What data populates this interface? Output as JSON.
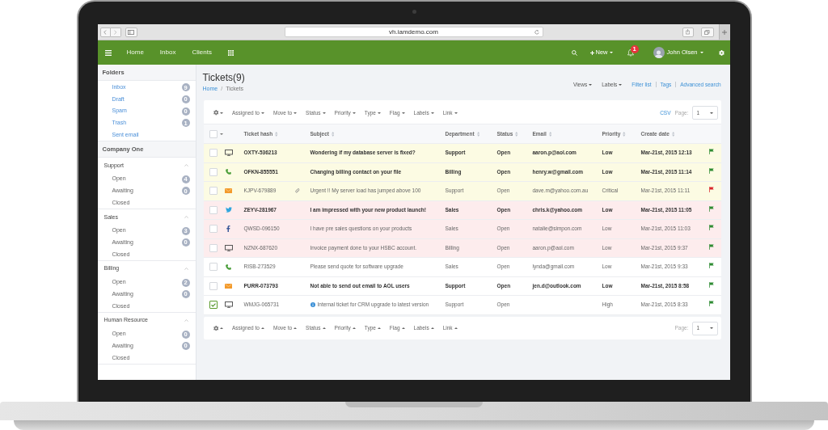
{
  "browser": {
    "url": "vh.iamdemo.com"
  },
  "navbar": {
    "links": [
      {
        "label": "Home"
      },
      {
        "label": "Inbox"
      },
      {
        "label": "Clients"
      }
    ],
    "new_label": "New",
    "notification_count": "1",
    "user_name": "John Olsen"
  },
  "sidebar": {
    "folders_title": "Folders",
    "folders": [
      {
        "label": "Inbox",
        "count": "9"
      },
      {
        "label": "Draft",
        "count": "0"
      },
      {
        "label": "Spam",
        "count": "0"
      },
      {
        "label": "Trash",
        "count": "1"
      },
      {
        "label": "Sent email"
      }
    ],
    "company_title": "Company One",
    "groups": [
      {
        "label": "Support",
        "expanded": true,
        "children": [
          {
            "label": "Open",
            "count": "4"
          },
          {
            "label": "Awaiting",
            "count": "0"
          },
          {
            "label": "Closed"
          }
        ]
      },
      {
        "label": "Sales",
        "expanded": true,
        "children": [
          {
            "label": "Open",
            "count": "3"
          },
          {
            "label": "Awaiting",
            "count": "0"
          },
          {
            "label": "Closed"
          }
        ]
      },
      {
        "label": "Billing",
        "expanded": true,
        "children": [
          {
            "label": "Open",
            "count": "2"
          },
          {
            "label": "Awaiting",
            "count": "0"
          },
          {
            "label": "Closed"
          }
        ]
      },
      {
        "label": "Human Resource",
        "expanded": true,
        "children": [
          {
            "label": "Open",
            "count": "0"
          },
          {
            "label": "Awaiting",
            "count": "0"
          },
          {
            "label": "Closed"
          }
        ]
      }
    ]
  },
  "header": {
    "title": "Tickets(9)",
    "breadcrumb": [
      "Home",
      "Tickets"
    ],
    "breadcrumb_separator": "/",
    "dropdowns": [
      "Views",
      "Labels"
    ],
    "links": [
      "Filter list",
      "Tags",
      "Advanced search"
    ]
  },
  "top_toolbar": {
    "actions": [
      "Assigned to",
      "Move to",
      "Status",
      "Priority",
      "Type",
      "Flag",
      "Labels",
      "Link"
    ],
    "csv_link": "CSV",
    "page_label": "Page:",
    "page_value": "1"
  },
  "table": {
    "all_checked": false,
    "columns": [
      "Ticket hash",
      "Subject",
      "Department",
      "Status",
      "Email",
      "Priority",
      "Create date"
    ],
    "rows": [
      {
        "checked": false,
        "unread": true,
        "color": "#fcfbe3",
        "channel": {
          "kind": "desktop"
        },
        "hash": "OXTY-536213",
        "attachment": false,
        "info": false,
        "subject": "Wondering if my database server is fixed?",
        "department": "Support",
        "status": "Open",
        "email": "aaron.p@aol.com",
        "priority": "Low",
        "created": "Mar-21st, 2015 12:13",
        "flag": {
          "color": "#2e8b32"
        }
      },
      {
        "checked": false,
        "unread": true,
        "color": "#fcfbe3",
        "channel": {
          "kind": "phone"
        },
        "hash": "OFKN-855551",
        "attachment": false,
        "info": false,
        "subject": "Changing billing contact on your file",
        "department": "Billing",
        "status": "Open",
        "email": "henry.w@gmail.com",
        "priority": "Low",
        "created": "Mar-21st, 2015 11:14",
        "flag": {
          "color": "#2e8b32"
        }
      },
      {
        "checked": false,
        "unread": false,
        "color": "#fcfbe3",
        "channel": {
          "kind": "email"
        },
        "hash": "KJPV-679889",
        "attachment": true,
        "info": false,
        "subject": "Urgent !! My server load has jumped above 100",
        "department": "Support",
        "status": "Open",
        "email": "dave.m@yahoo.com.au",
        "priority": "Critical",
        "created": "Mar-21st, 2015 11:11",
        "flag": {
          "color": "#d9262c"
        }
      },
      {
        "checked": false,
        "unread": true,
        "color": "#fdeced",
        "channel": {
          "kind": "twitter"
        },
        "hash": "ZEYV-281967",
        "attachment": false,
        "info": false,
        "subject": "I am impressed with your new product launch!",
        "department": "Sales",
        "status": "Open",
        "email": "chris.k@yahoo.com",
        "priority": "Low",
        "created": "Mar-21st, 2015 11:05",
        "flag": {
          "color": "#2e8b32"
        }
      },
      {
        "checked": false,
        "unread": false,
        "color": "#fdeced",
        "channel": {
          "kind": "facebook"
        },
        "hash": "QWSD-096150",
        "attachment": false,
        "info": false,
        "subject": "I have pre sales questions on your products",
        "department": "Sales",
        "status": "Open",
        "email": "natalie@simpon.com",
        "priority": "Low",
        "created": "Mar-21st, 2015 11:03",
        "flag": {
          "color": "#2e8b32"
        }
      },
      {
        "checked": false,
        "unread": false,
        "color": "#fdeced",
        "channel": {
          "kind": "desktop"
        },
        "hash": "NZNX-687620",
        "attachment": false,
        "info": false,
        "subject": "Invoice payment done to your HSBC account.",
        "department": "Billing",
        "status": "Open",
        "email": "aaron.p@aol.com",
        "priority": "Low",
        "created": "Mar-21st, 2015 9:37",
        "flag": {
          "color": "#2e8b32"
        }
      },
      {
        "checked": false,
        "unread": false,
        "color": "#ffffff",
        "channel": {
          "kind": "phone"
        },
        "hash": "RISB-273529",
        "attachment": false,
        "info": false,
        "subject": "Please send quote for software upgrade",
        "department": "Sales",
        "status": "Open",
        "email": "lynda@gmail.com",
        "priority": "Low",
        "created": "Mar-21st, 2015 9:33",
        "flag": {
          "color": "#2e8b32"
        }
      },
      {
        "checked": false,
        "unread": true,
        "color": "#ffffff",
        "channel": {
          "kind": "email"
        },
        "hash": "PURR-073793",
        "attachment": false,
        "info": false,
        "subject": "Not able to send out email to AOL users",
        "department": "Support",
        "status": "Open",
        "email": "jen.d@outlook.com",
        "priority": "Low",
        "created": "Mar-21st, 2015 8:58",
        "flag": {
          "color": "#2e8b32"
        }
      },
      {
        "checked": true,
        "unread": false,
        "color": "#ffffff",
        "channel": {
          "kind": "desktop"
        },
        "hash": "WMJG-065731",
        "attachment": false,
        "info": true,
        "subject": "Internal ticket for CRM upgrade to latest version",
        "department": "Support",
        "status": "Open",
        "priority": "High",
        "created": "Mar-21st, 2015 8:33",
        "flag": {
          "color": "#2e8b32"
        }
      }
    ]
  },
  "bottom_toolbar": {
    "actions": [
      "Assigned to",
      "Move to",
      "Status",
      "Priority",
      "Type",
      "Flag",
      "Labels",
      "Link"
    ],
    "page_label": "Page:",
    "page_value": "1"
  }
}
